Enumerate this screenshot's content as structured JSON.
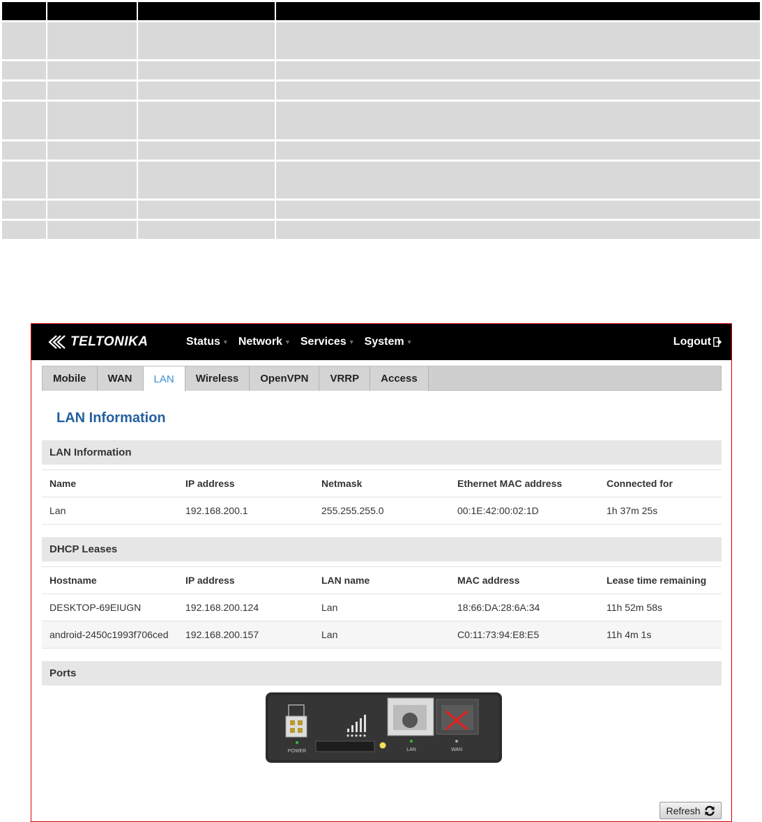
{
  "brand": {
    "name": "TELTONIKA"
  },
  "menu": [
    {
      "label": "Status"
    },
    {
      "label": "Network"
    },
    {
      "label": "Services"
    },
    {
      "label": "System"
    }
  ],
  "logout_label": "Logout",
  "tabs": [
    {
      "label": "Mobile",
      "active": false
    },
    {
      "label": "WAN",
      "active": false
    },
    {
      "label": "LAN",
      "active": true
    },
    {
      "label": "Wireless",
      "active": false
    },
    {
      "label": "OpenVPN",
      "active": false
    },
    {
      "label": "VRRP",
      "active": false
    },
    {
      "label": "Access",
      "active": false
    }
  ],
  "page_title": "LAN Information",
  "lan_info": {
    "section_title": "LAN Information",
    "headers": [
      "Name",
      "IP address",
      "Netmask",
      "Ethernet MAC address",
      "Connected for"
    ],
    "rows": [
      [
        "Lan",
        "192.168.200.1",
        "255.255.255.0",
        "00:1E:42:00:02:1D",
        "1h 37m 25s"
      ]
    ]
  },
  "dhcp": {
    "section_title": "DHCP Leases",
    "headers": [
      "Hostname",
      "IP address",
      "LAN name",
      "MAC address",
      "Lease time remaining"
    ],
    "rows": [
      [
        "DESKTOP-69EIUGN",
        "192.168.200.124",
        "Lan",
        "18:66:DA:28:6A:34",
        "11h 52m 58s"
      ],
      [
        "android-2450c1993f706ced",
        "192.168.200.157",
        "Lan",
        "C0:11:73:94:E8:E5",
        "11h 4m 1s"
      ]
    ]
  },
  "ports": {
    "section_title": "Ports",
    "labels": {
      "power": "POWER",
      "lan": "LAN",
      "wan": "WAN"
    }
  },
  "refresh_label": "Refresh",
  "colors": {
    "frame_border": "#d40000",
    "accent_blue": "#24609e",
    "active_tab": "#3b8fd0",
    "led_green": "#2fc13a",
    "wan_cross": "#e02020"
  }
}
